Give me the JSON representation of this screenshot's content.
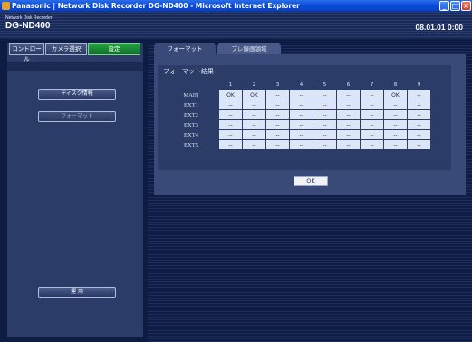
{
  "window": {
    "title": "Panasonic | Network Disk Recorder DG-ND400 - Microsoft Internet Explorer",
    "controls": [
      "_",
      "□",
      "×"
    ]
  },
  "header": {
    "subtitle": "Network Disk Recorder",
    "model": "DG-ND400",
    "datetime": "08.01.01  0:00"
  },
  "left_tabs": {
    "control": "コントロール",
    "camera": "カメラ選択",
    "settings": "設定"
  },
  "left_buttons": {
    "disk_info": "ディスク情報",
    "format": "フォーマット",
    "apply": "運 用"
  },
  "right_tabs": {
    "format": "フォーマット",
    "pre_record": "プレ録画領域"
  },
  "format_result": {
    "title": "フォーマット結果",
    "columns": [
      "1",
      "2",
      "3",
      "4",
      "5",
      "6",
      "7",
      "8",
      "9"
    ],
    "rows": [
      {
        "label": "MAIN",
        "cells": [
          "OK",
          "OK",
          "--",
          "--",
          "--",
          "--",
          "--",
          "OK",
          "--"
        ]
      },
      {
        "label": "EXT1",
        "cells": [
          "--",
          "--",
          "--",
          "--",
          "--",
          "--",
          "--",
          "--",
          "--"
        ]
      },
      {
        "label": "EXT2",
        "cells": [
          "--",
          "--",
          "--",
          "--",
          "--",
          "--",
          "--",
          "--",
          "--"
        ]
      },
      {
        "label": "EXT3",
        "cells": [
          "--",
          "--",
          "--",
          "--",
          "--",
          "--",
          "--",
          "--",
          "--"
        ]
      },
      {
        "label": "EXT4",
        "cells": [
          "--",
          "--",
          "--",
          "--",
          "--",
          "--",
          "--",
          "--",
          "--"
        ]
      },
      {
        "label": "EXT5",
        "cells": [
          "--",
          "--",
          "--",
          "--",
          "--",
          "--",
          "--",
          "--",
          "--"
        ]
      }
    ],
    "ok_button": "OK"
  }
}
